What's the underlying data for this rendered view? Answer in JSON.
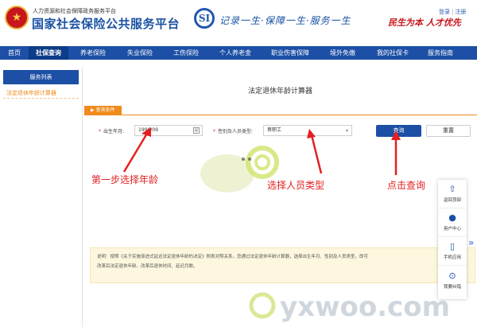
{
  "header": {
    "site_subtitle": "人力资源和社会保障政务服务平台",
    "site_title": "国家社会保险公共服务平台",
    "slogan": "记录一生·保障一生·服务一生",
    "motto": "民生为本 人才优先",
    "login": "登录",
    "separator": "|",
    "register": "注册"
  },
  "nav": {
    "items": [
      {
        "label": "首页",
        "width": 36
      },
      {
        "label": "社保查询",
        "width": 50,
        "active": true
      },
      {
        "label": "养老保险",
        "width": 62
      },
      {
        "label": "失业保险",
        "width": 56
      },
      {
        "label": "工伤保险",
        "width": 60
      },
      {
        "label": "个人养老金",
        "width": 64
      },
      {
        "label": "职业伤害保障",
        "width": 74
      },
      {
        "label": "境外免缴",
        "width": 58
      },
      {
        "label": "我的社保卡",
        "width": 68
      },
      {
        "label": "服务指南",
        "width": 52
      }
    ]
  },
  "sidebar": {
    "title": "服务列表",
    "items": [
      {
        "label": "法定退休年龄计算器"
      }
    ]
  },
  "main": {
    "title": "法定退休年龄计算器",
    "conditions_label": "查询条件",
    "birth_label": "出生年月:",
    "birth_value": "1996/09",
    "type_label": "性别及人员类型:",
    "type_value": "男职工",
    "query_button": "查询",
    "reset_button": "重置",
    "info_text_1": "说明：按照《关于实施渐进式延迟法定退休年龄的决定》附表对照关系，您通过法定退休年龄计算器，选择出生年月、性别及人员类型，即可",
    "info_text_2": "改革后法定退休年龄、改革后退休时间、延迟月数。"
  },
  "annotations": {
    "step1": "第一步选择年龄",
    "step2": "选择人员类型",
    "step3": "点击查询"
  },
  "float_panel": {
    "items": [
      {
        "label": "返回顶部",
        "icon": "arrow-up-icon",
        "glyph": "⇧"
      },
      {
        "label": "用户中心",
        "icon": "user-icon",
        "glyph": "●"
      },
      {
        "label": "手机应用",
        "icon": "phone-icon",
        "glyph": "▯"
      },
      {
        "label": "我要纠错",
        "icon": "magnifier-icon",
        "glyph": "⊙"
      }
    ],
    "expand": "»"
  },
  "watermark": "yxwoo.com",
  "colors": {
    "brand_blue": "#1c4fa5",
    "accent_orange": "#f08a1c",
    "annotation_red": "#e32020"
  }
}
